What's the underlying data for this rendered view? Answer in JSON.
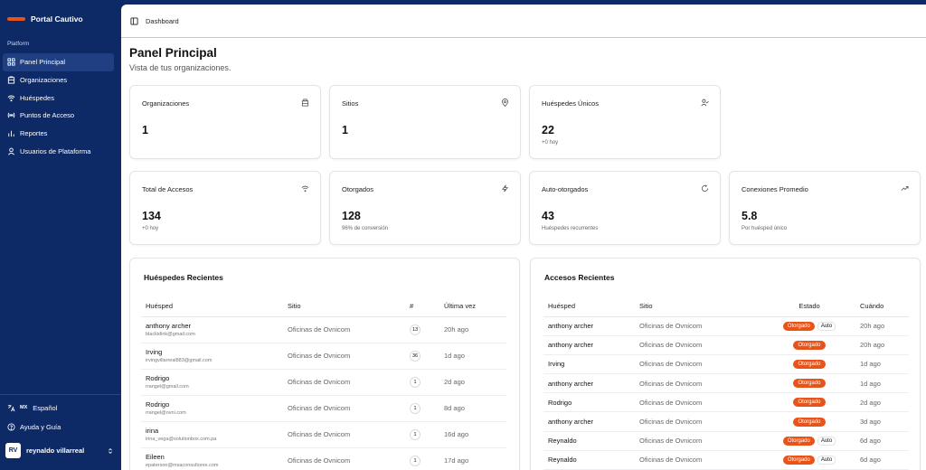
{
  "sidebar": {
    "brand": "Portal Cautivo",
    "section_label": "Platform",
    "items": [
      {
        "label": "Panel Principal",
        "icon": "dashboard-icon",
        "active": true
      },
      {
        "label": "Organizaciones",
        "icon": "building-icon",
        "active": false
      },
      {
        "label": "Huéspedes",
        "icon": "wifi-icon",
        "active": false
      },
      {
        "label": "Puntos de Acceso",
        "icon": "access-point-icon",
        "active": false
      },
      {
        "label": "Reportes",
        "icon": "chart-icon",
        "active": false
      },
      {
        "label": "Usuarios de Plataforma",
        "icon": "users-icon",
        "active": false
      }
    ],
    "language": {
      "code": "MX",
      "label": "Español"
    },
    "help": "Ayuda y Guía",
    "user": {
      "initials": "RV",
      "name": "reynaldo villarreal"
    }
  },
  "header": {
    "breadcrumb": "Dashboard"
  },
  "page": {
    "title": "Panel Principal",
    "subtitle": "Vista de tus organizaciones."
  },
  "stats_row1": [
    {
      "label": "Organizaciones",
      "value": "1",
      "sub": "",
      "icon": "building-icon"
    },
    {
      "label": "Sitios",
      "value": "1",
      "sub": "",
      "icon": "map-pin-icon"
    },
    {
      "label": "Huéspedes Únicos",
      "value": "22",
      "sub": "+0 hoy",
      "icon": "user-check-icon"
    }
  ],
  "stats_row2": [
    {
      "label": "Total de Accesos",
      "value": "134",
      "sub": "+0 hoy",
      "icon": "wifi-icon"
    },
    {
      "label": "Otorgados",
      "value": "128",
      "sub": "96% de conversión",
      "icon": "zap-icon"
    },
    {
      "label": "Auto-otorgados",
      "value": "43",
      "sub": "Huéspedes recurrentes",
      "icon": "refresh-icon"
    },
    {
      "label": "Conexiones Promedio",
      "value": "5.8",
      "sub": "Por huésped único",
      "icon": "trending-up-icon"
    }
  ],
  "recent_guests": {
    "title": "Huéspedes Recientes",
    "columns": [
      "Huésped",
      "Sitio",
      "#",
      "Última vez"
    ],
    "rows": [
      {
        "name": "anthony archer",
        "email": "blackidink@gmail.com",
        "site": "Oficinas de Ovnicom",
        "count": "13",
        "last": "20h ago"
      },
      {
        "name": "Irving",
        "email": "irvingvillarreal883@gmail.com",
        "site": "Oficinas de Ovnicom",
        "count": "36",
        "last": "1d ago"
      },
      {
        "name": "Rodrigo",
        "email": "rrangel@gmail.com",
        "site": "Oficinas de Ovnicom",
        "count": "1",
        "last": "2d ago"
      },
      {
        "name": "Rodrigo",
        "email": "rrangel@ovni.com",
        "site": "Oficinas de Ovnicom",
        "count": "1",
        "last": "8d ago"
      },
      {
        "name": "irina",
        "email": "irina_vega@solutionbox.com.pa",
        "site": "Oficinas de Ovnicom",
        "count": "1",
        "last": "16d ago"
      },
      {
        "name": "Eileen",
        "email": "epaterson@msaconsultores.com",
        "site": "Oficinas de Ovnicom",
        "count": "1",
        "last": "17d ago"
      }
    ]
  },
  "recent_access": {
    "title": "Accesos Recientes",
    "columns": [
      "Huésped",
      "Sitio",
      "Estado",
      "Cuándo"
    ],
    "rows": [
      {
        "name": "anthony archer",
        "site": "Oficinas de Ovnicom",
        "status": "Otorgado",
        "auto": "Auto",
        "when": "20h ago"
      },
      {
        "name": "anthony archer",
        "site": "Oficinas de Ovnicom",
        "status": "Otorgado",
        "auto": "",
        "when": "20h ago"
      },
      {
        "name": "Irving",
        "site": "Oficinas de Ovnicom",
        "status": "Otorgado",
        "auto": "",
        "when": "1d ago"
      },
      {
        "name": "anthony archer",
        "site": "Oficinas de Ovnicom",
        "status": "Otorgado",
        "auto": "",
        "when": "1d ago"
      },
      {
        "name": "Rodrigo",
        "site": "Oficinas de Ovnicom",
        "status": "Otorgado",
        "auto": "",
        "when": "2d ago"
      },
      {
        "name": "anthony archer",
        "site": "Oficinas de Ovnicom",
        "status": "Otorgado",
        "auto": "",
        "when": "3d ago"
      },
      {
        "name": "Reynaldo",
        "site": "Oficinas de Ovnicom",
        "status": "Otorgado",
        "auto": "Auto",
        "when": "6d ago"
      },
      {
        "name": "Reynaldo",
        "site": "Oficinas de Ovnicom",
        "status": "Otorgado",
        "auto": "Auto",
        "when": "6d ago"
      }
    ]
  },
  "colors": {
    "sidebar": "#0d2a66",
    "accent": "#e8531a"
  }
}
